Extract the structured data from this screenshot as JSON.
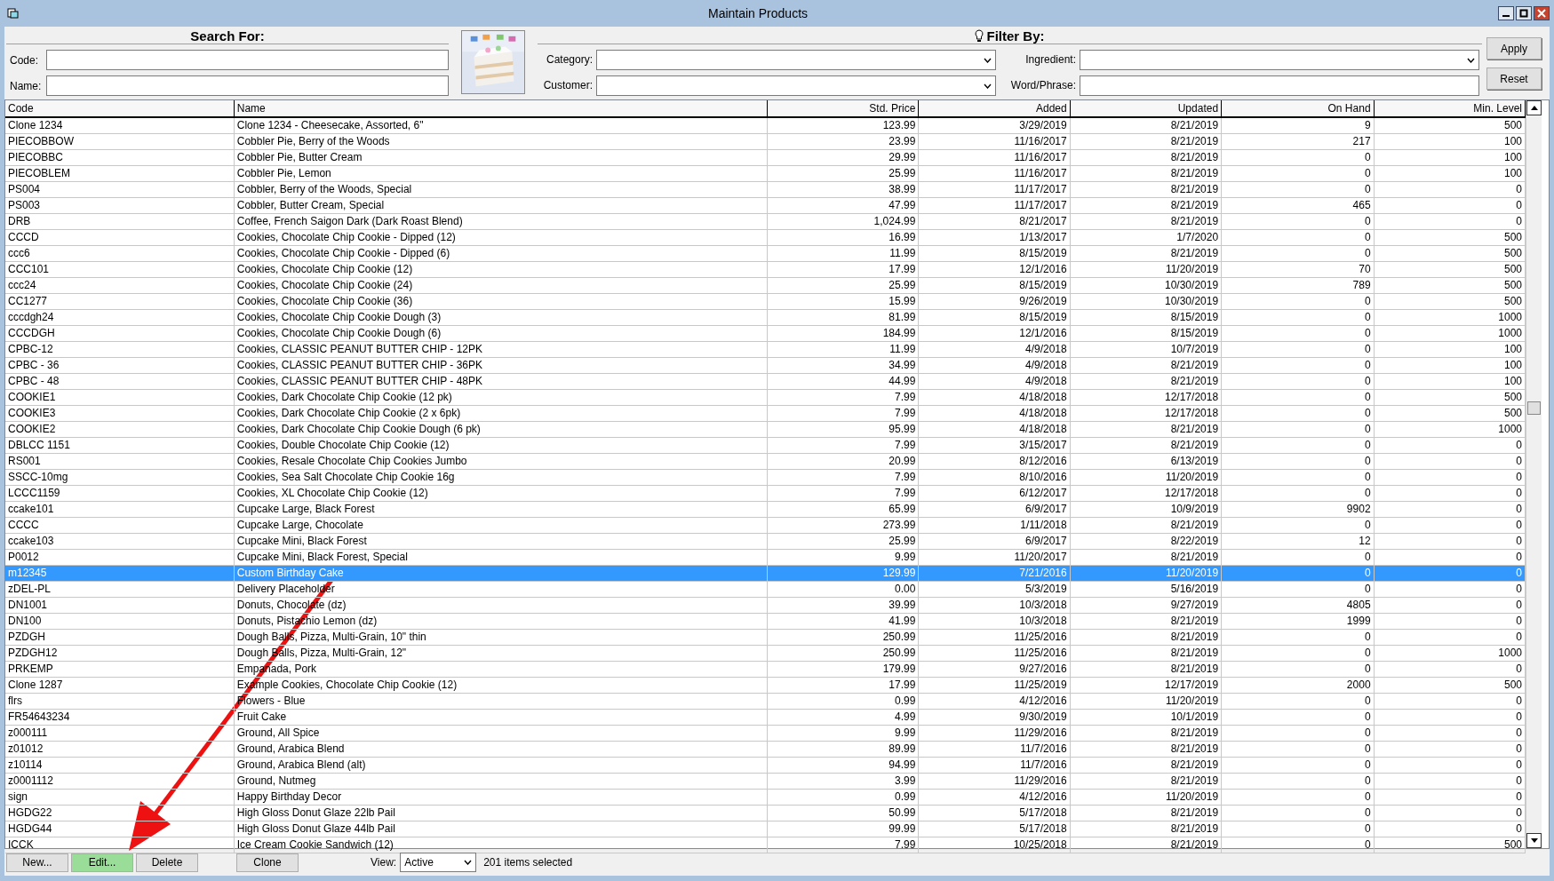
{
  "window": {
    "title": "Maintain Products"
  },
  "search": {
    "heading": "Search For:",
    "fields": [
      {
        "label": "Code:"
      },
      {
        "label": "Name:"
      }
    ]
  },
  "filter": {
    "heading": "Filter By:",
    "fields": [
      {
        "label": "Category:",
        "kind": "dropdown"
      },
      {
        "label": "Ingredient:",
        "kind": "dropdown"
      },
      {
        "label": "Customer:",
        "kind": "dropdown"
      },
      {
        "label": "Word/Phrase:",
        "kind": "text"
      }
    ],
    "buttons": [
      "Apply",
      "Reset"
    ]
  },
  "table": {
    "columns": [
      {
        "label": "Code"
      },
      {
        "label": "Name"
      },
      {
        "label": "Std. Price"
      },
      {
        "label": "Added"
      },
      {
        "label": "Updated"
      },
      {
        "label": "On Hand"
      },
      {
        "label": "Min. Level"
      }
    ],
    "rows": [
      {
        "cells": [
          "Clone 1234",
          "Clone 1234 - Cheesecake, Assorted, 6\"",
          "123.99",
          "3/29/2019",
          "8/21/2019",
          "9",
          "500"
        ],
        "selected": false
      },
      {
        "cells": [
          "PIECOBBOW",
          "Cobbler Pie, Berry of the Woods",
          "23.99",
          "11/16/2017",
          "8/21/2019",
          "217",
          "100"
        ],
        "selected": false
      },
      {
        "cells": [
          "PIECOBBC",
          "Cobbler Pie, Butter Cream",
          "29.99",
          "11/16/2017",
          "8/21/2019",
          "0",
          "100"
        ],
        "selected": false
      },
      {
        "cells": [
          "PIECOBLEM",
          "Cobbler Pie, Lemon",
          "25.99",
          "11/16/2017",
          "8/21/2019",
          "0",
          "100"
        ],
        "selected": false
      },
      {
        "cells": [
          "PS004",
          "Cobbler, Berry of the Woods, Special",
          "38.99",
          "11/17/2017",
          "8/21/2019",
          "0",
          "0"
        ],
        "selected": false
      },
      {
        "cells": [
          "PS003",
          "Cobbler, Butter Cream, Special",
          "47.99",
          "11/17/2017",
          "8/21/2019",
          "465",
          "0"
        ],
        "selected": false
      },
      {
        "cells": [
          "DRB",
          "Coffee, French Saigon Dark (Dark Roast Blend)",
          "1,024.99",
          "8/21/2017",
          "8/21/2019",
          "0",
          "0"
        ],
        "selected": false
      },
      {
        "cells": [
          "CCCD",
          "Cookies, Chocolate Chip Cookie - Dipped (12)",
          "16.99",
          "1/13/2017",
          "1/7/2020",
          "0",
          "500"
        ],
        "selected": false
      },
      {
        "cells": [
          "ccc6",
          "Cookies, Chocolate Chip Cookie - Dipped (6)",
          "11.99",
          "8/15/2019",
          "8/21/2019",
          "0",
          "500"
        ],
        "selected": false
      },
      {
        "cells": [
          "CCC101",
          "Cookies, Chocolate Chip Cookie (12)",
          "17.99",
          "12/1/2016",
          "11/20/2019",
          "70",
          "500"
        ],
        "selected": false
      },
      {
        "cells": [
          "ccc24",
          "Cookies, Chocolate Chip Cookie (24)",
          "25.99",
          "8/15/2019",
          "10/30/2019",
          "789",
          "500"
        ],
        "selected": false
      },
      {
        "cells": [
          "CC1277",
          "Cookies, Chocolate Chip Cookie (36)",
          "15.99",
          "9/26/2019",
          "10/30/2019",
          "0",
          "500"
        ],
        "selected": false
      },
      {
        "cells": [
          "cccdgh24",
          "Cookies, Chocolate Chip Cookie Dough (3)",
          "81.99",
          "8/15/2019",
          "8/15/2019",
          "0",
          "1000"
        ],
        "selected": false
      },
      {
        "cells": [
          "CCCDGH",
          "Cookies, Chocolate Chip Cookie Dough (6)",
          "184.99",
          "12/1/2016",
          "8/15/2019",
          "0",
          "1000"
        ],
        "selected": false
      },
      {
        "cells": [
          "CPBC-12",
          "Cookies, CLASSIC PEANUT BUTTER CHIP - 12PK",
          "11.99",
          "4/9/2018",
          "10/7/2019",
          "0",
          "100"
        ],
        "selected": false
      },
      {
        "cells": [
          "CPBC - 36",
          "Cookies, CLASSIC PEANUT BUTTER CHIP - 36PK",
          "34.99",
          "4/9/2018",
          "8/21/2019",
          "0",
          "100"
        ],
        "selected": false
      },
      {
        "cells": [
          "CPBC - 48",
          "Cookies, CLASSIC PEANUT BUTTER CHIP - 48PK",
          "44.99",
          "4/9/2018",
          "8/21/2019",
          "0",
          "100"
        ],
        "selected": false
      },
      {
        "cells": [
          "COOKIE1",
          "Cookies, Dark Chocolate Chip Cookie (12 pk)",
          "7.99",
          "4/18/2018",
          "12/17/2018",
          "0",
          "500"
        ],
        "selected": false
      },
      {
        "cells": [
          "COOKIE3",
          "Cookies, Dark Chocolate Chip Cookie (2 x 6pk)",
          "7.99",
          "4/18/2018",
          "12/17/2018",
          "0",
          "500"
        ],
        "selected": false
      },
      {
        "cells": [
          "COOKIE2",
          "Cookies, Dark Chocolate Chip Cookie Dough (6 pk)",
          "95.99",
          "4/18/2018",
          "8/21/2019",
          "0",
          "1000"
        ],
        "selected": false
      },
      {
        "cells": [
          "DBLCC 1151",
          "Cookies, Double Chocolate Chip Cookie (12)",
          "7.99",
          "3/15/2017",
          "8/21/2019",
          "0",
          "0"
        ],
        "selected": false
      },
      {
        "cells": [
          "RS001",
          "Cookies, Resale Chocolate Chip Cookies Jumbo",
          "20.99",
          "8/12/2016",
          "6/13/2019",
          "0",
          "0"
        ],
        "selected": false
      },
      {
        "cells": [
          "SSCC-10mg",
          "Cookies, Sea Salt Chocolate Chip Cookie 16g",
          "7.99",
          "8/10/2016",
          "11/20/2019",
          "0",
          "0"
        ],
        "selected": false
      },
      {
        "cells": [
          "LCCC1159",
          "Cookies, XL Chocolate Chip Cookie (12)",
          "7.99",
          "6/12/2017",
          "12/17/2018",
          "0",
          "0"
        ],
        "selected": false
      },
      {
        "cells": [
          "ccake101",
          "Cupcake Large, Black Forest",
          "65.99",
          "6/9/2017",
          "10/9/2019",
          "9902",
          "0"
        ],
        "selected": false
      },
      {
        "cells": [
          "CCCC",
          "Cupcake Large, Chocolate",
          "273.99",
          "1/11/2018",
          "8/21/2019",
          "0",
          "0"
        ],
        "selected": false
      },
      {
        "cells": [
          "ccake103",
          "Cupcake Mini, Black Forest",
          "25.99",
          "6/9/2017",
          "8/22/2019",
          "12",
          "0"
        ],
        "selected": false
      },
      {
        "cells": [
          "P0012",
          "Cupcake Mini, Black Forest, Special",
          "9.99",
          "11/20/2017",
          "8/21/2019",
          "0",
          "0"
        ],
        "selected": false
      },
      {
        "cells": [
          "m12345",
          "Custom Birthday Cake",
          "129.99",
          "7/21/2016",
          "11/20/2019",
          "0",
          "0"
        ],
        "selected": true
      },
      {
        "cells": [
          "zDEL-PL",
          "Delivery Placeholder",
          "0.00",
          "5/3/2019",
          "5/16/2019",
          "0",
          "0"
        ],
        "selected": false
      },
      {
        "cells": [
          "DN1001",
          "Donuts, Chocolate (dz)",
          "39.99",
          "10/3/2018",
          "9/27/2019",
          "4805",
          "0"
        ],
        "selected": false
      },
      {
        "cells": [
          "DN100",
          "Donuts, Pistachio Lemon (dz)",
          "41.99",
          "10/3/2018",
          "8/21/2019",
          "1999",
          "0"
        ],
        "selected": false
      },
      {
        "cells": [
          "PZDGH",
          "Dough Balls, Pizza, Multi-Grain, 10\" thin",
          "250.99",
          "11/25/2016",
          "8/21/2019",
          "0",
          "0"
        ],
        "selected": false
      },
      {
        "cells": [
          "PZDGH12",
          "Dough Balls, Pizza, Multi-Grain, 12\"",
          "250.99",
          "11/25/2016",
          "8/21/2019",
          "0",
          "1000"
        ],
        "selected": false
      },
      {
        "cells": [
          "PRKEMP",
          "Empanada, Pork",
          "179.99",
          "9/27/2016",
          "8/21/2019",
          "0",
          "0"
        ],
        "selected": false
      },
      {
        "cells": [
          "Clone 1287",
          "Example Cookies, Chocolate Chip Cookie (12)",
          "17.99",
          "11/25/2019",
          "12/17/2019",
          "2000",
          "500"
        ],
        "selected": false
      },
      {
        "cells": [
          "flrs",
          "Flowers - Blue",
          "0.99",
          "4/12/2016",
          "11/20/2019",
          "0",
          "0"
        ],
        "selected": false
      },
      {
        "cells": [
          "FR54643234",
          "Fruit Cake",
          "4.99",
          "9/30/2019",
          "10/1/2019",
          "0",
          "0"
        ],
        "selected": false
      },
      {
        "cells": [
          "z000111",
          "Ground, All Spice",
          "9.99",
          "11/29/2016",
          "8/21/2019",
          "0",
          "0"
        ],
        "selected": false
      },
      {
        "cells": [
          "z01012",
          "Ground, Arabica Blend",
          "89.99",
          "11/7/2016",
          "8/21/2019",
          "0",
          "0"
        ],
        "selected": false
      },
      {
        "cells": [
          "z10114",
          "Ground, Arabica Blend (alt)",
          "94.99",
          "11/7/2016",
          "8/21/2019",
          "0",
          "0"
        ],
        "selected": false
      },
      {
        "cells": [
          "z0001112",
          "Ground, Nutmeg",
          "3.99",
          "11/29/2016",
          "8/21/2019",
          "0",
          "0"
        ],
        "selected": false
      },
      {
        "cells": [
          "sign",
          "Happy Birthday Decor",
          "0.99",
          "4/12/2016",
          "11/20/2019",
          "0",
          "0"
        ],
        "selected": false
      },
      {
        "cells": [
          "HGDG22",
          "High Gloss Donut Glaze 22lb Pail",
          "50.99",
          "5/17/2018",
          "8/21/2019",
          "0",
          "0"
        ],
        "selected": false
      },
      {
        "cells": [
          "HGDG44",
          "High Gloss Donut Glaze 44lb Pail",
          "99.99",
          "5/17/2018",
          "8/21/2019",
          "0",
          "0"
        ],
        "selected": false
      },
      {
        "cells": [
          "ICCK",
          "Ice Cream Cookie Sandwich (12)",
          "7.99",
          "10/25/2018",
          "8/21/2019",
          "0",
          "500"
        ],
        "selected": false
      }
    ]
  },
  "footer": {
    "buttons": [
      {
        "label": "New...",
        "highlighted": false
      },
      {
        "label": "Edit...",
        "highlighted": true
      },
      {
        "label": "Delete",
        "highlighted": false
      },
      {
        "label": "Clone",
        "highlighted": false
      }
    ],
    "view": {
      "label": "View:",
      "value": "Active"
    },
    "status": "201 items selected"
  }
}
